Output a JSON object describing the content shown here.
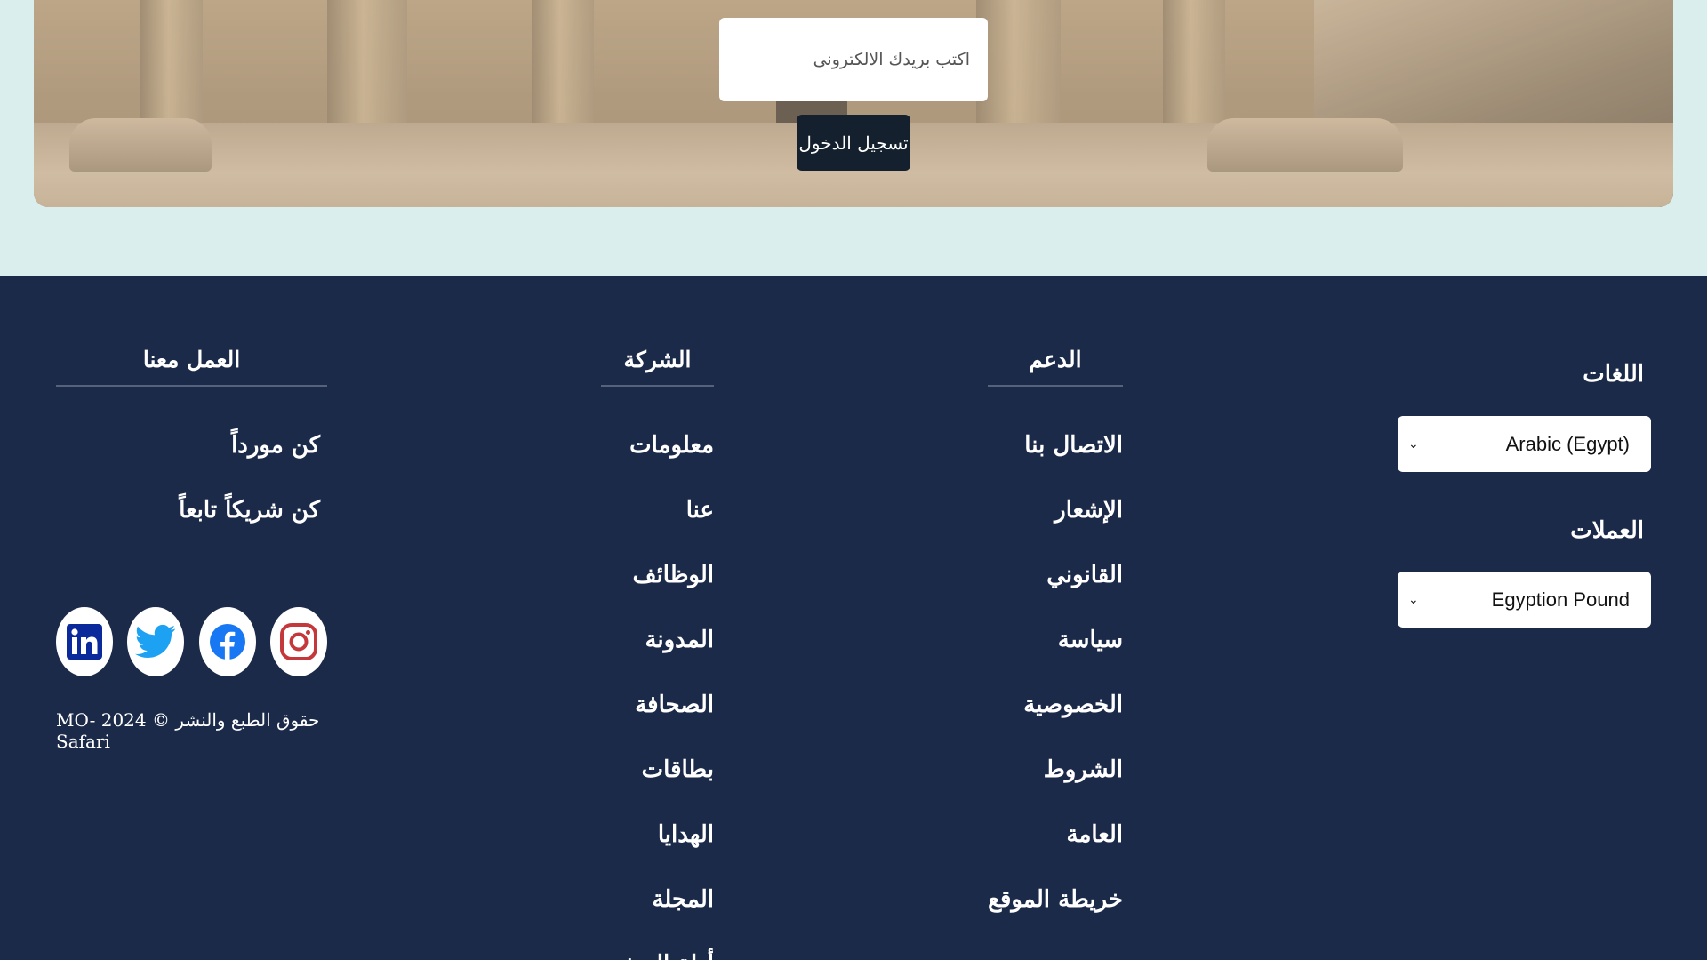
{
  "newsletter": {
    "email_placeholder": "اكتب بريدك الالكترونى",
    "login_label": "تسجيل الدخول"
  },
  "footer": {
    "support": {
      "heading": "الدعم",
      "links": [
        "الاتصال بنا",
        "الإشعار القانوني",
        "سياسة الخصوصية",
        "الشروط العامة",
        "خريطة الموقع"
      ]
    },
    "company": {
      "heading": "الشركة",
      "links": [
        "معلومات عنا",
        "الوظائف",
        "المدونة",
        "الصحافة",
        "بطاقات الهدايا",
        "المجلة",
        "أدلة السفر"
      ]
    },
    "work": {
      "heading": "العمل معنا",
      "links": [
        "كن مورداً",
        "كن شريكاً تابعاً"
      ]
    },
    "languages": {
      "label": "اللغات",
      "selected": "Arabic (Egypt)"
    },
    "currencies": {
      "label": "العملات",
      "selected": "Egyption Pound"
    },
    "socials": [
      "instagram-icon",
      "facebook-icon",
      "twitter-icon",
      "linkedin-icon"
    ],
    "copyright": "حقوق الطبع والنشر © 2024 MO-Safari"
  },
  "colors": {
    "page_bg": "#dbeeee",
    "footer_bg": "#1c2a4a",
    "button_bg": "#14202e",
    "instagram": "#c13584",
    "facebook": "#1877f2",
    "twitter": "#1da1f2",
    "linkedin": "#0a2a9c"
  }
}
